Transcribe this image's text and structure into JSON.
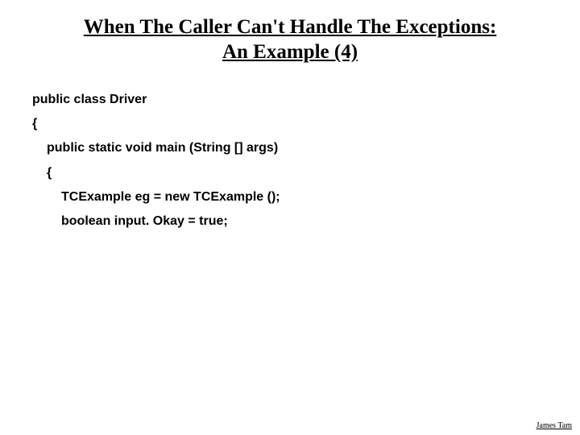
{
  "title": "When The Caller Can't Handle The Exceptions: An Example (4)",
  "code": {
    "l1": "public class Driver",
    "l2": "{",
    "l3": "public static void main (String [] args)",
    "l4": "{",
    "l5": "TCExample eg = new TCExample ();",
    "l6": "boolean input. Okay = true;"
  },
  "footer": "James Tam"
}
